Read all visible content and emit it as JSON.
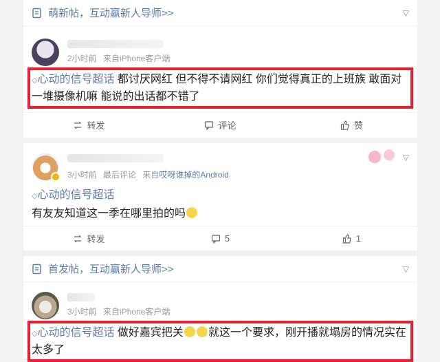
{
  "card1": {
    "header": "萌新帖，互动赢新人导师>>",
    "time": "2小时前",
    "source": "来自iPhone客户端",
    "topic": "心动的信号超话",
    "text": " 都讨厌网红 但不得不请网红 你们觉得真正的上班族 敢面对一堆摄像机嘛 能说的出话都不错了",
    "actions": {
      "repost": "转发",
      "comment": "评论",
      "like": "赞"
    }
  },
  "card2": {
    "time": "3小时前",
    "last_comment": "最后评论",
    "source_prefix": "来自",
    "source": "哎呀谁掉的Android",
    "topic": "心动的信号超话",
    "text": "有友友知道这一季在哪里拍的吗",
    "actions": {
      "repost": "转发",
      "comment": "5",
      "like": "1"
    }
  },
  "card3": {
    "header": "首发帖，互动赢新人导师>>",
    "time": "3小时前",
    "source": "来自iPhone客户端",
    "topic": "心动的信号超话",
    "text_a": " 做好嘉宾把关",
    "text_b": "就这一个要求，刚开播就塌房的情况实在太多了"
  },
  "colors": {
    "link": "#5b7ba6",
    "highlight_box": "#e8202e",
    "verified_badge": "#f5b400"
  }
}
